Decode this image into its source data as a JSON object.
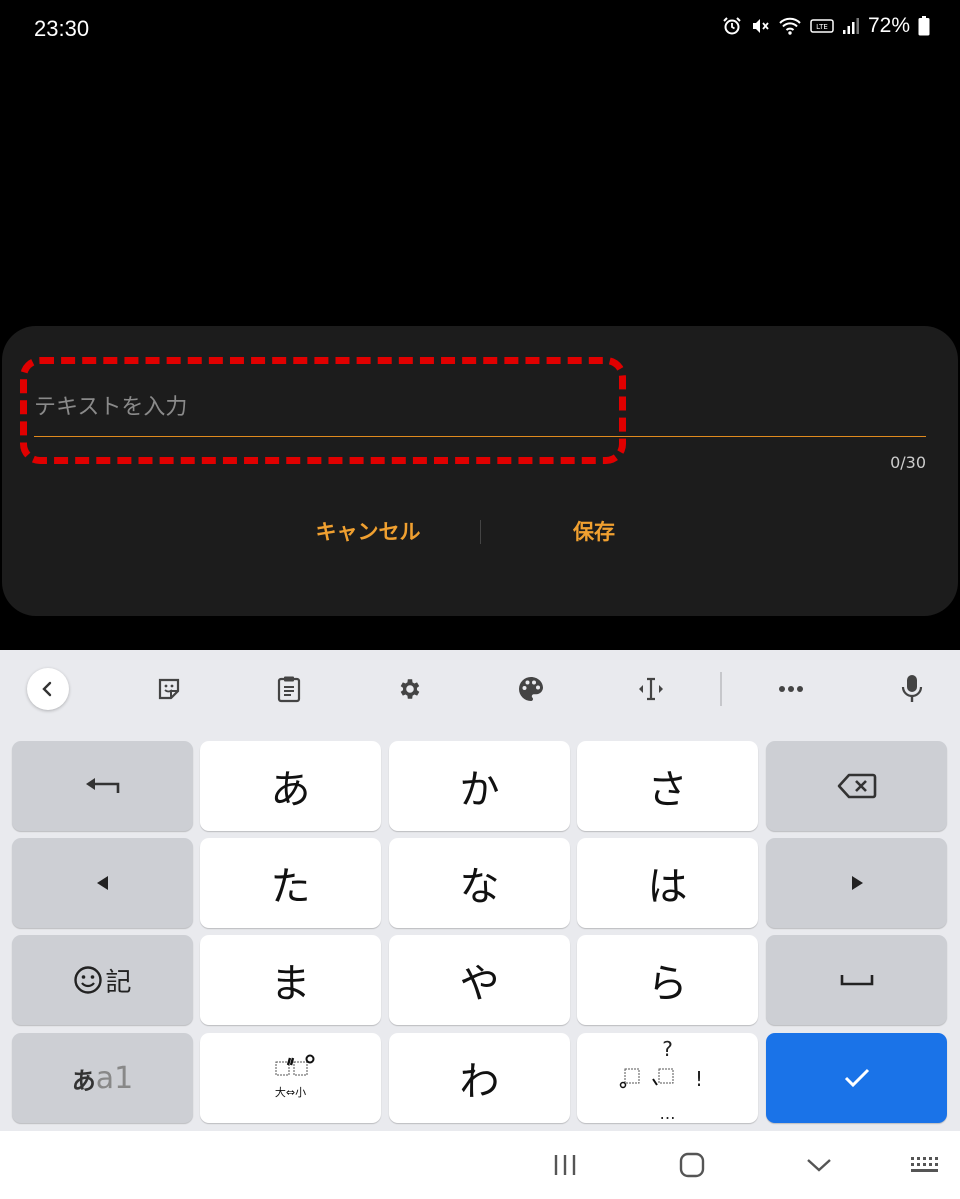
{
  "status_bar": {
    "time": "23:30",
    "battery": "72%"
  },
  "dialog": {
    "input_placeholder": "テキストを入力",
    "input_value": "",
    "char_counter": "0/30",
    "cancel_label": "キャンセル",
    "save_label": "保存"
  },
  "keyboard": {
    "toolbar": [
      "back-icon",
      "sticker-icon",
      "clipboard-icon",
      "gear-icon",
      "palette-icon",
      "cursor-icon",
      "more-icon",
      "microphone-icon"
    ],
    "keys": {
      "a": "あ",
      "ka": "か",
      "sa": "さ",
      "ta": "た",
      "na": "な",
      "ha": "は",
      "ma": "ま",
      "ya": "や",
      "ra": "ら",
      "wa": "わ",
      "emoji_label": "記",
      "mode_kana": "あ",
      "mode_alpha": "a1",
      "dakuten_label": "大⇔小",
      "punct_q": "?",
      "punct_excl": "!",
      "punct_dots": "…"
    }
  },
  "colors": {
    "accent": "#f0a030",
    "underline": "#e08a1e",
    "highlight": "#e00000",
    "enter": "#1a73e8"
  }
}
